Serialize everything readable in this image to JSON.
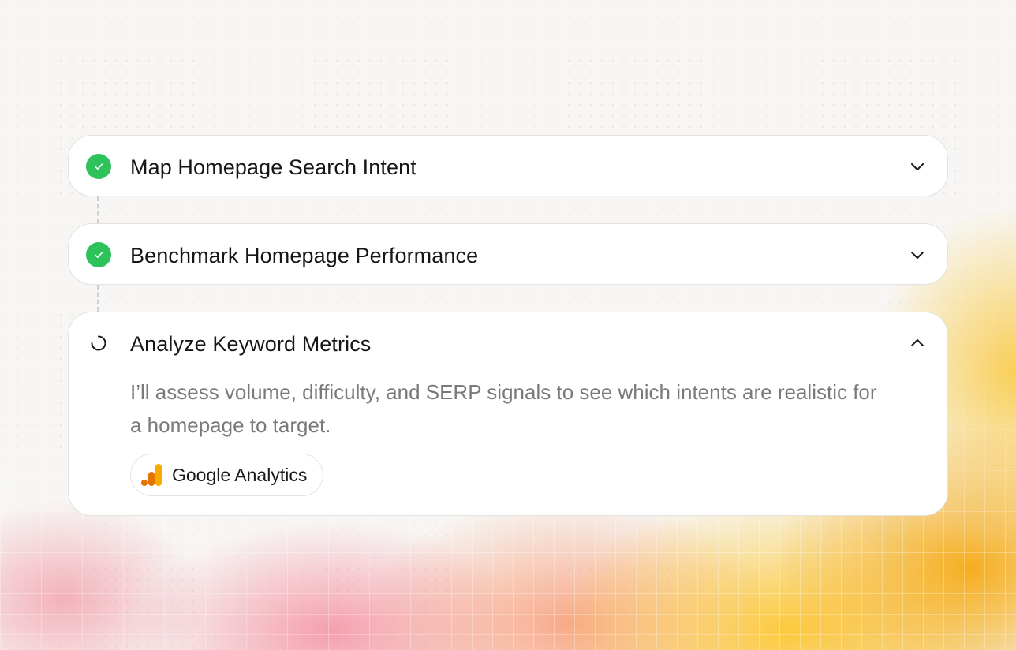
{
  "steps": [
    {
      "title": "Map Homepage Search Intent",
      "status": "completed",
      "status_icon": "check-circle-icon",
      "expanded": false,
      "toggle_icon": "chevron-down-icon"
    },
    {
      "title": "Benchmark Homepage Performance",
      "status": "completed",
      "status_icon": "check-circle-icon",
      "expanded": false,
      "toggle_icon": "chevron-down-icon"
    },
    {
      "title": "Analyze Keyword Metrics",
      "status": "in-progress",
      "status_icon": "spinner-icon",
      "expanded": true,
      "toggle_icon": "chevron-up-icon",
      "description": "I’ll assess volume, difficulty, and SERP signals to see which intents are realistic for a homepage to target.",
      "tool": {
        "label": "Google Analytics",
        "icon": "google-analytics-icon"
      }
    }
  ],
  "colors": {
    "success_green": "#2ec25a",
    "card_bg": "#ffffff",
    "card_border": "#e4e3e0",
    "title_text": "#161616",
    "description_text": "#7a7a7a",
    "ga_orange_dark": "#e37400",
    "ga_orange_light": "#f9ab00"
  }
}
